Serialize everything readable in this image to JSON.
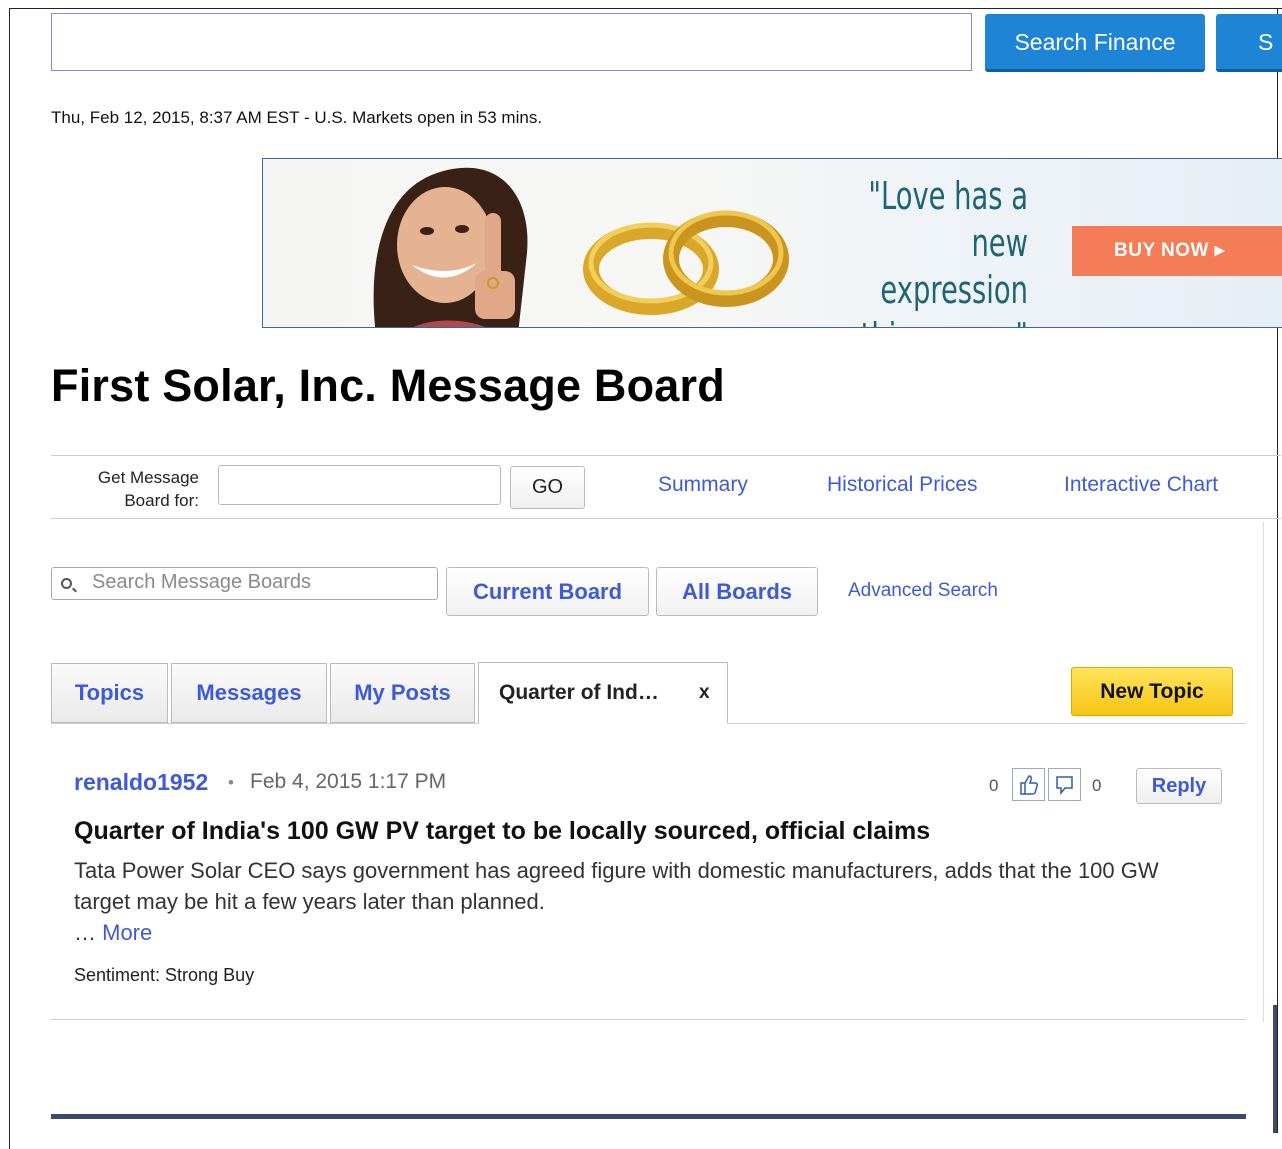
{
  "header": {
    "search_value": "",
    "search_finance_label": "Search Finance",
    "search_web_label": "S",
    "market_status": "Thu, Feb 12, 2015, 8:37 AM EST - U.S. Markets open in 53 mins."
  },
  "ad": {
    "quote": "\"Love has a new expression this season\"",
    "quote_lines": [
      "\"Love has a",
      "new expression",
      "this season\""
    ],
    "cta": "BUY NOW ▸"
  },
  "page_title": "First Solar, Inc. Message Board",
  "quote_bar": {
    "label": "Get Message Board for:",
    "label_line1": "Get Message",
    "label_line2": "Board for:",
    "input_value": "",
    "go_label": "GO",
    "links": [
      "Summary",
      "Historical Prices",
      "Interactive Chart"
    ]
  },
  "board_search": {
    "placeholder": "Search Message Boards",
    "current_board_label": "Current Board",
    "all_boards_label": "All Boards",
    "advanced_label": "Advanced Search"
  },
  "tabs": {
    "items": [
      "Topics",
      "Messages",
      "My Posts"
    ],
    "active_label": "Quarter of Ind…",
    "close_label": "x",
    "new_topic_label": "New Topic"
  },
  "post": {
    "author": "renaldo1952",
    "separator": "•",
    "date": "Feb 4, 2015 1:17 PM",
    "thumbs_up": "0",
    "thumbs_down": "0",
    "reply_label": "Reply",
    "headline": "Quarter of India's 100 GW PV target to be locally sourced, official claims",
    "body": "Tata Power Solar CEO says government has agreed figure with domestic manufacturers, adds that the 100 GW target may be hit a few years later than planned.",
    "more_prefix": "…",
    "more_label": "More",
    "sentiment": "Sentiment: Strong Buy"
  },
  "colors": {
    "link": "#3d5bd6",
    "primary_button": "#1d84d6",
    "new_topic_button": "#f6c511",
    "ad_cta": "#f47d58"
  }
}
